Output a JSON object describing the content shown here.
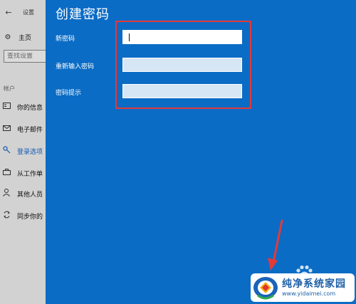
{
  "settings": {
    "app_title": "设置",
    "home_label": "主页",
    "search_placeholder": "查找设置",
    "section_label": "帐户",
    "nav_items": [
      {
        "label": "你的信息",
        "icon": "contact-card-icon"
      },
      {
        "label": "电子邮件",
        "icon": "mail-icon"
      },
      {
        "label": "登录选项",
        "icon": "key-icon"
      },
      {
        "label": "从工作单",
        "icon": "briefcase-icon"
      },
      {
        "label": "其他人员",
        "icon": "person-icon"
      },
      {
        "label": "同步你的",
        "icon": "sync-icon"
      }
    ],
    "selected_item": "登录选项"
  },
  "dialog": {
    "title": "创建密码",
    "fields": [
      {
        "label": "新密码",
        "value": "",
        "active": true
      },
      {
        "label": "重新输入密码",
        "value": "",
        "active": false
      },
      {
        "label": "密码提示",
        "value": "",
        "active": false
      }
    ]
  },
  "annotation": {
    "highlight_color": "#e23a3a",
    "arrow_color": "#e23a3a"
  },
  "watermark": {
    "name": "纯净系统家园",
    "url": "www.yidaimei.com"
  },
  "colors": {
    "dialog_bg": "#0b6cc5",
    "accent": "#1a66c8"
  }
}
